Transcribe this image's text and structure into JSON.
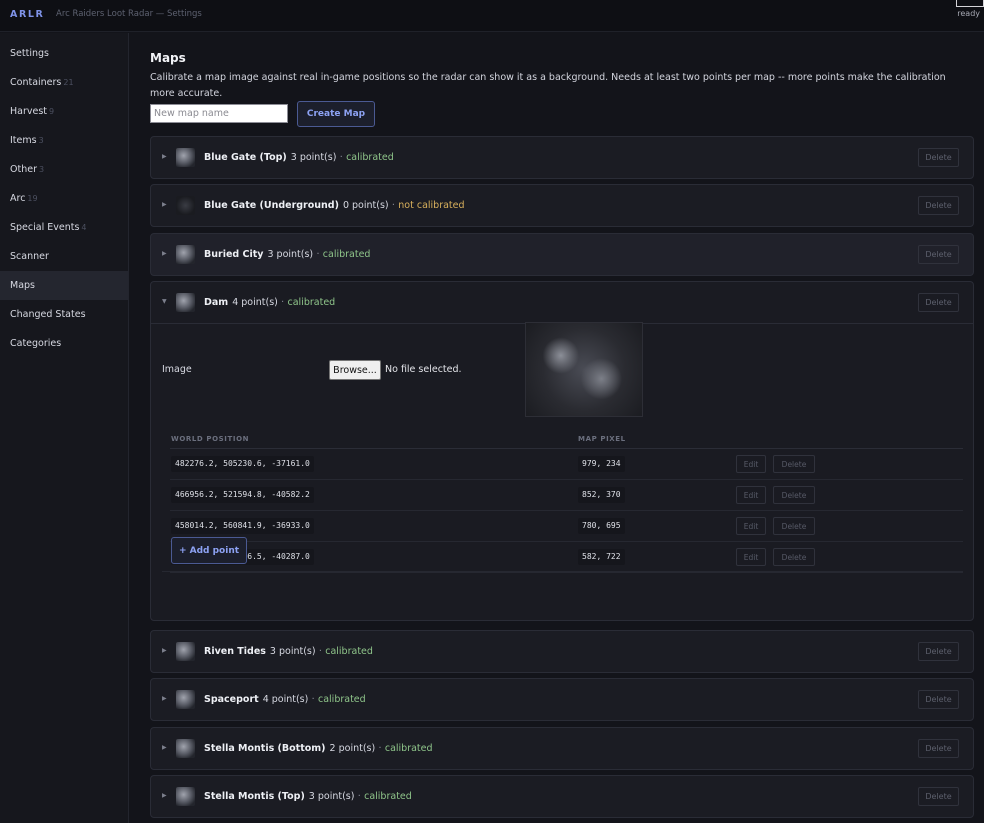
{
  "header": {
    "brand": "ARLR",
    "title": "Arc Raiders Loot Radar — Settings",
    "status": "ready"
  },
  "sidebar": {
    "items": [
      {
        "label": "Settings",
        "count": ""
      },
      {
        "label": "Containers",
        "count": "21"
      },
      {
        "label": "Harvest",
        "count": "9"
      },
      {
        "label": "Items",
        "count": "3"
      },
      {
        "label": "Other",
        "count": "3"
      },
      {
        "label": "Arc",
        "count": "19"
      },
      {
        "label": "Special Events",
        "count": "4"
      },
      {
        "label": "Scanner",
        "count": ""
      },
      {
        "label": "Maps",
        "count": "",
        "active": true
      },
      {
        "label": "Changed States",
        "count": ""
      },
      {
        "label": "Categories",
        "count": ""
      }
    ]
  },
  "main": {
    "title": "Maps",
    "description": "Calibrate a map image against real in-game positions so the radar can show it as a background. Needs at least two points per map -- more points make the calibration more accurate.",
    "new_map_placeholder": "New map name",
    "create_label": "Create Map",
    "delete_label": "Delete",
    "maps": [
      {
        "name": "Blue Gate (Top)",
        "points": "3 point(s)",
        "sep": "·",
        "status": "calibrated",
        "calibrated": true
      },
      {
        "name": "Blue Gate (Underground)",
        "points": "0 point(s)",
        "sep": "·",
        "status": "not calibrated",
        "calibrated": false
      },
      {
        "name": "Buried City",
        "points": "3 point(s)",
        "sep": "·",
        "status": "calibrated",
        "calibrated": true
      },
      {
        "name": "Dam",
        "points": "4 point(s)",
        "sep": "·",
        "status": "calibrated",
        "calibrated": true,
        "expanded": true
      },
      {
        "name": "Riven Tides",
        "points": "3 point(s)",
        "sep": "·",
        "status": "calibrated",
        "calibrated": true
      },
      {
        "name": "Spaceport",
        "points": "4 point(s)",
        "sep": "·",
        "status": "calibrated",
        "calibrated": true
      },
      {
        "name": "Stella Montis (Bottom)",
        "points": "2 point(s)",
        "sep": "·",
        "status": "calibrated",
        "calibrated": true
      },
      {
        "name": "Stella Montis (Top)",
        "points": "3 point(s)",
        "sep": "·",
        "status": "calibrated",
        "calibrated": true
      }
    ],
    "detail": {
      "image_label": "Image",
      "browse_label": "Browse...",
      "no_file": "No file selected.",
      "col_world": "WORLD POSITION",
      "col_pixel": "MAP PIXEL",
      "edit_label": "Edit",
      "delete_label": "Delete",
      "points": [
        {
          "world": "482276.2, 505230.6, -37161.0",
          "pixel": "979, 234"
        },
        {
          "world": "466956.2, 521594.8, -40582.2",
          "pixel": "852, 370"
        },
        {
          "world": "458014.2, 560841.9, -36933.0",
          "pixel": "780, 695"
        },
        {
          "world": "434130.9, 564176.5, -40287.0",
          "pixel": "582, 722"
        }
      ],
      "add_point_label": "+ Add point"
    }
  }
}
